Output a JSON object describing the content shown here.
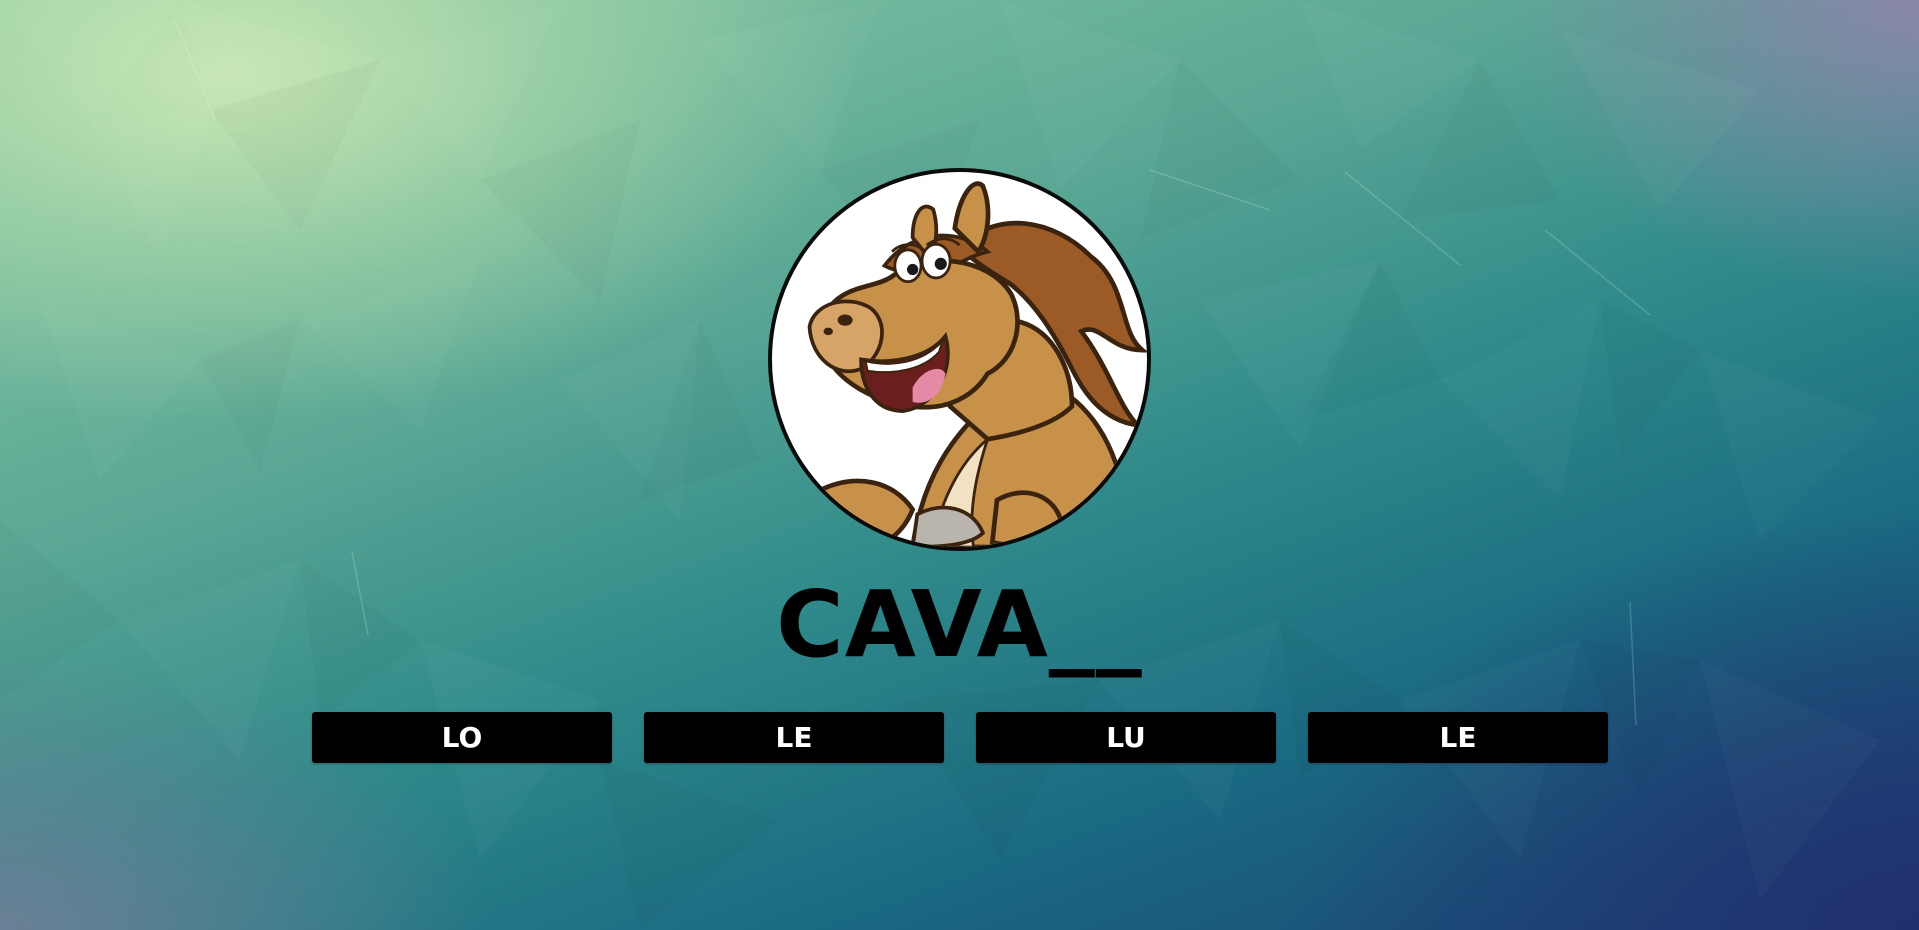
{
  "site": {
    "title": "CAVA__",
    "logo_icon": "cartoon-horse-icon"
  },
  "nav": {
    "buttons": [
      {
        "label": "LO"
      },
      {
        "label": "LE"
      },
      {
        "label": "LU"
      },
      {
        "label": "LE"
      }
    ]
  },
  "colors": {
    "button_bg": "#000000",
    "button_text": "#ffffff",
    "title_text": "#000000",
    "logo_border": "#0b0b0b"
  }
}
